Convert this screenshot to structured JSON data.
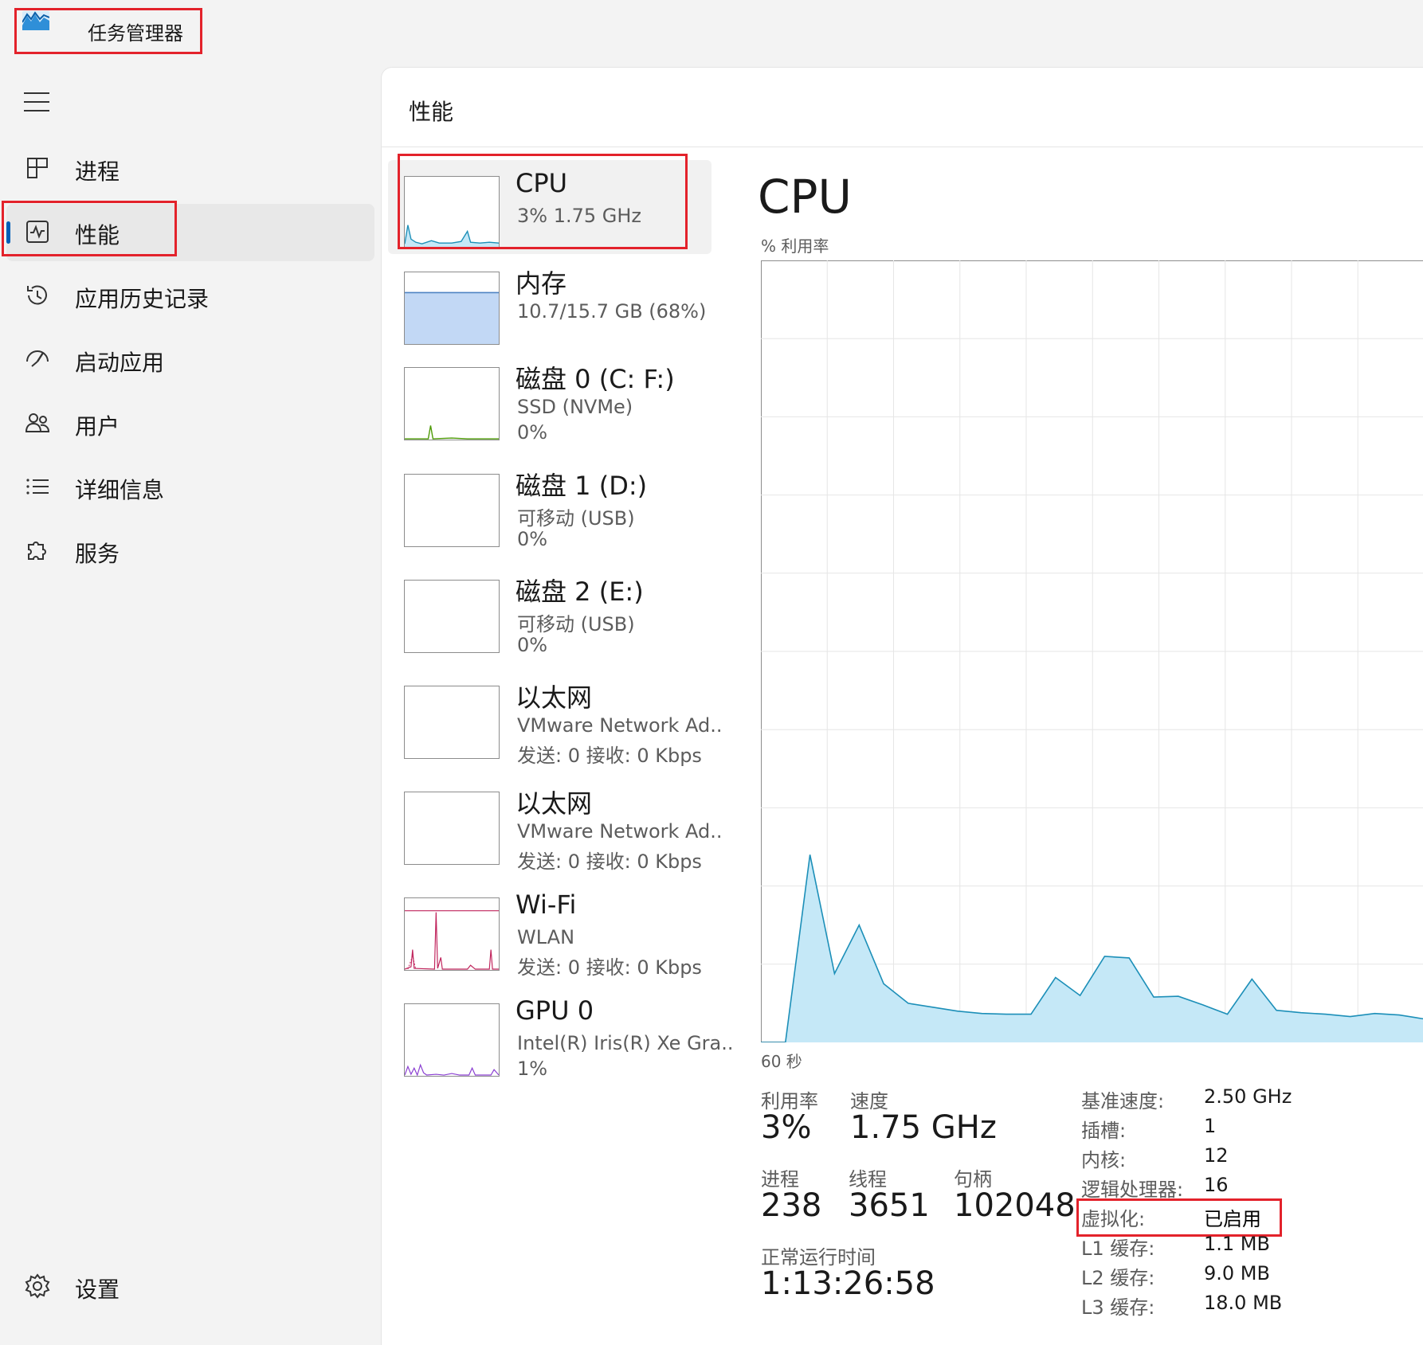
{
  "app": {
    "title": "任务管理器"
  },
  "sidebar": {
    "items": [
      {
        "label": "进程"
      },
      {
        "label": "性能"
      },
      {
        "label": "应用历史记录"
      },
      {
        "label": "启动应用"
      },
      {
        "label": "用户"
      },
      {
        "label": "详细信息"
      },
      {
        "label": "服务"
      }
    ],
    "settings_label": "设置"
  },
  "main": {
    "page_title": "性能"
  },
  "resources": [
    {
      "name": "CPU",
      "sub1": "3%  1.75 GHz",
      "sub2": "",
      "color": "#1c8fb8"
    },
    {
      "name": "内存",
      "sub1": "10.7/15.7 GB (68%)",
      "sub2": "",
      "color": "#4f84c4"
    },
    {
      "name": "磁盘 0 (C: F:)",
      "sub1": "SSD (NVMe)",
      "sub2": "0%",
      "color": "#4d9a06"
    },
    {
      "name": "磁盘 1 (D:)",
      "sub1": "可移动 (USB)",
      "sub2": "0%",
      "color": "#4d9a06"
    },
    {
      "name": "磁盘 2 (E:)",
      "sub1": "可移动 (USB)",
      "sub2": "0%",
      "color": "#4d9a06"
    },
    {
      "name": "以太网",
      "sub1": "VMware Network Ad..",
      "sub2": "发送: 0 接收: 0 Kbps",
      "color": "#a74f01"
    },
    {
      "name": "以太网",
      "sub1": "VMware Network Ad..",
      "sub2": "发送: 0 接收: 0 Kbps",
      "color": "#a74f01"
    },
    {
      "name": "Wi-Fi",
      "sub1": "WLAN",
      "sub2": "发送: 0 接收: 0 Kbps",
      "color": "#c0245c"
    },
    {
      "name": "GPU 0",
      "sub1": "Intel(R) Iris(R) Xe Gra..",
      "sub2": "1%",
      "color": "#8a3fd1"
    }
  ],
  "cpu": {
    "heading": "CPU",
    "util_label": "% 利用率",
    "x_label": "60 秒",
    "utilization": {
      "label": "利用率",
      "value": "3%"
    },
    "speed": {
      "label": "速度",
      "value": "1.75 GHz"
    },
    "processes": {
      "label": "进程",
      "value": "238"
    },
    "threads": {
      "label": "线程",
      "value": "3651"
    },
    "handles": {
      "label": "句柄",
      "value": "102048"
    },
    "uptime": {
      "label": "正常运行时间",
      "value": "1:13:26:58"
    },
    "specs": [
      {
        "key": "基准速度:",
        "value": "2.50 GHz"
      },
      {
        "key": "插槽:",
        "value": "1"
      },
      {
        "key": "内核:",
        "value": "12"
      },
      {
        "key": "逻辑处理器:",
        "value": "16"
      },
      {
        "key": "虚拟化:",
        "value": "已启用"
      },
      {
        "key": "L1 缓存:",
        "value": "1.1 MB"
      },
      {
        "key": "L2 缓存:",
        "value": "9.0 MB"
      },
      {
        "key": "L3 缓存:",
        "value": "18.0 MB"
      }
    ],
    "graph_color": "#1c8fb8",
    "graph_fill": "#c5e8f7",
    "history_percent": [
      0,
      0,
      24,
      8.8,
      15,
      7.5,
      5,
      4.5,
      4,
      3.7,
      3.6,
      3.6,
      8.3,
      6,
      11,
      10.8,
      5.8,
      5.9,
      4.8,
      3.6,
      8.1,
      4.1,
      3.8,
      3.6,
      3.3,
      3.7,
      3.5,
      3.0
    ]
  },
  "highlight_color": "#e3222b",
  "accent_color": "#005fb8"
}
